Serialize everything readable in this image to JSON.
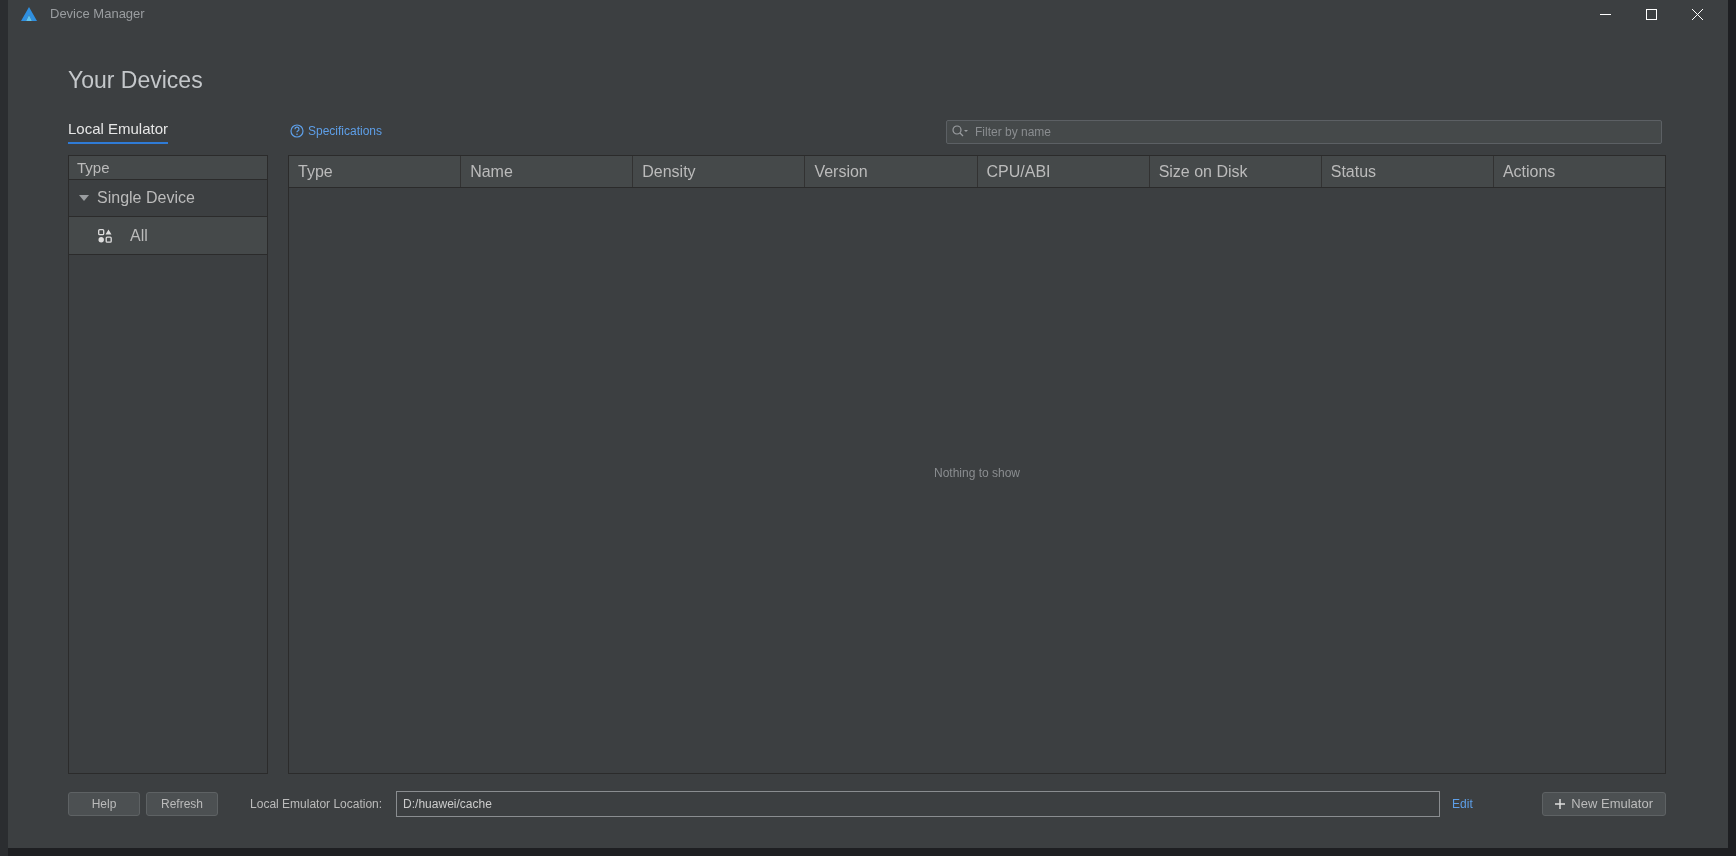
{
  "window": {
    "title": "Device Manager"
  },
  "heading": "Your Devices",
  "tabs": [
    {
      "label": "Local Emulator",
      "selected": true
    }
  ],
  "specifications_link": "Specifications",
  "filter": {
    "placeholder": "Filter by name"
  },
  "type_panel": {
    "header": "Type",
    "groups": [
      {
        "label": "Single Device",
        "expanded": true,
        "children": [
          {
            "label": "All",
            "selected": true
          }
        ]
      }
    ]
  },
  "table": {
    "columns": [
      "Type",
      "Name",
      "Density",
      "Version",
      "CPU/ABI",
      "Size on Disk",
      "Status",
      "Actions"
    ],
    "empty_message": "Nothing to show"
  },
  "footer": {
    "buttons": [
      "Help",
      "Refresh"
    ],
    "location_label": "Local Emulator Location:",
    "location_value": "D:/huawei/cache",
    "edit_link": "Edit",
    "new_button": "New Emulator"
  }
}
